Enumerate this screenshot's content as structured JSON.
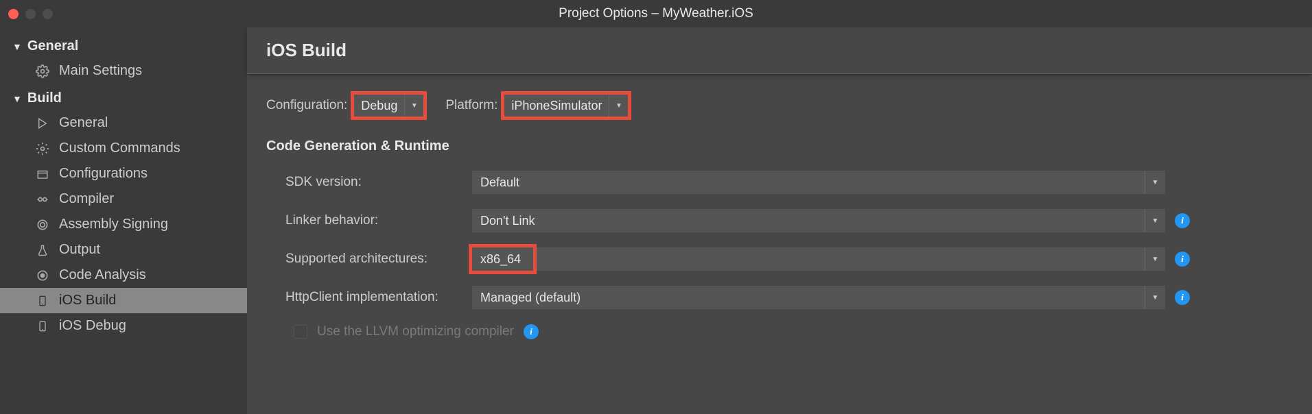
{
  "window": {
    "title": "Project Options – MyWeather.iOS"
  },
  "sidebar": {
    "sections": [
      {
        "title": "General",
        "items": [
          {
            "label": "Main Settings",
            "icon": "gear"
          }
        ]
      },
      {
        "title": "Build",
        "items": [
          {
            "label": "General",
            "icon": "play"
          },
          {
            "label": "Custom Commands",
            "icon": "gear"
          },
          {
            "label": "Configurations",
            "icon": "box"
          },
          {
            "label": "Compiler",
            "icon": "robot"
          },
          {
            "label": "Assembly Signing",
            "icon": "seal"
          },
          {
            "label": "Output",
            "icon": "flask"
          },
          {
            "label": "Code Analysis",
            "icon": "target"
          },
          {
            "label": "iOS Build",
            "icon": "phone",
            "selected": true
          },
          {
            "label": "iOS Debug",
            "icon": "phone"
          }
        ]
      }
    ]
  },
  "content": {
    "title": "iOS Build",
    "config": {
      "configuration_label": "Configuration:",
      "configuration_value": "Debug",
      "platform_label": "Platform:",
      "platform_value": "iPhoneSimulator"
    },
    "section_title": "Code Generation & Runtime",
    "fields": {
      "sdk_label": "SDK version:",
      "sdk_value": "Default",
      "linker_label": "Linker behavior:",
      "linker_value": "Don't Link",
      "arch_label": "Supported architectures:",
      "arch_value": "x86_64",
      "httpclient_label": "HttpClient implementation:",
      "httpclient_value": "Managed (default)",
      "llvm_label": "Use the LLVM optimizing compiler"
    }
  }
}
